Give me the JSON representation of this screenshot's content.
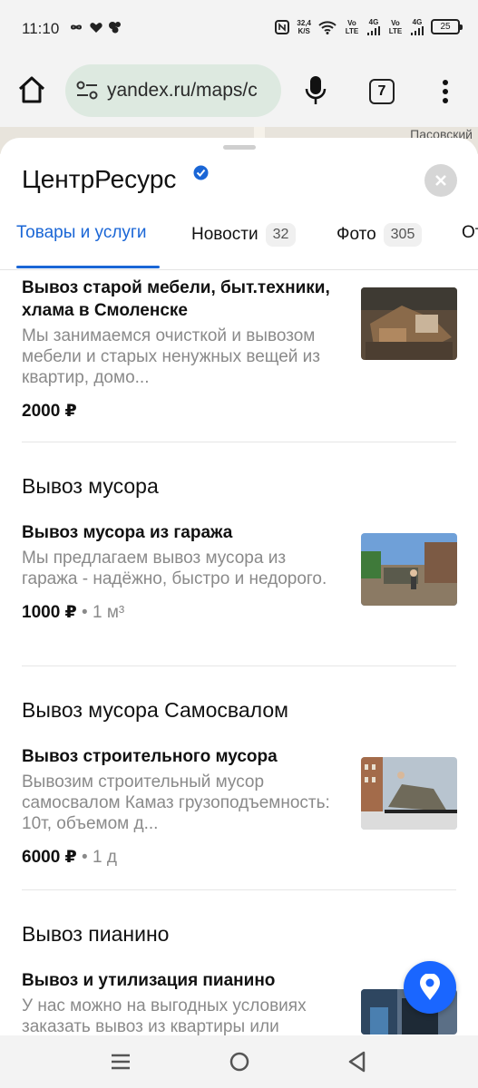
{
  "status": {
    "time": "11:10",
    "net_speed_value": "32,4",
    "net_speed_unit": "K/S",
    "volte_1": "Vo LTE",
    "net_1": "4G",
    "volte_2": "Vo LTE",
    "net_2": "4G",
    "battery": "25"
  },
  "browser": {
    "url": "yandex.ru/maps/c",
    "tabs_count": "7"
  },
  "map": {
    "label": "Пасовский"
  },
  "org": {
    "title": "ЦентрРесурс"
  },
  "tabs": [
    {
      "label": "Товары и услуги",
      "count": ""
    },
    {
      "label": "Новости",
      "count": "32"
    },
    {
      "label": "Фото",
      "count": "305"
    },
    {
      "label": "От",
      "count": ""
    }
  ],
  "items": [
    {
      "title": "Вывоз старой мебели, быт.техники, хлама в Смоленске",
      "desc": "Мы занимаемся очисткой и вывозом мебели и старых ненужных вещей из квартир, домо...",
      "price": "2000 ₽",
      "unit": ""
    },
    {
      "section": "Вывоз мусора",
      "title": "Вывоз мусора из гаража",
      "desc": "Мы предлагаем вывоз мусора из гаража - надёжно, быстро и недорого.",
      "price": "1000 ₽",
      "unit": " • 1 м³"
    },
    {
      "section": "Вывоз мусора Самосвалом",
      "title": "Вывоз строительного мусора",
      "desc": "Вывозим строительный мусор самосвалом Камаз грузоподъемность: 10т, объемом д...",
      "price": "6000 ₽",
      "unit": " • 1 д"
    },
    {
      "section": "Вывоз пианино",
      "title": "Вывоз и утилизация пианино",
      "desc": "У нас можно на выгодных условиях заказать вывоз из квартиры или",
      "price": "",
      "unit": ""
    }
  ],
  "colors": {
    "accent": "#1a66d6",
    "fab": "#1a66ff",
    "url_pill": "#dde9e0"
  },
  "icons": [
    "home-icon",
    "site-settings-icon",
    "mic-icon",
    "tabs-icon",
    "overflow-menu-icon",
    "verified-icon",
    "close-icon",
    "location-pin-icon",
    "recents-icon",
    "home-circle-icon",
    "back-icon"
  ]
}
